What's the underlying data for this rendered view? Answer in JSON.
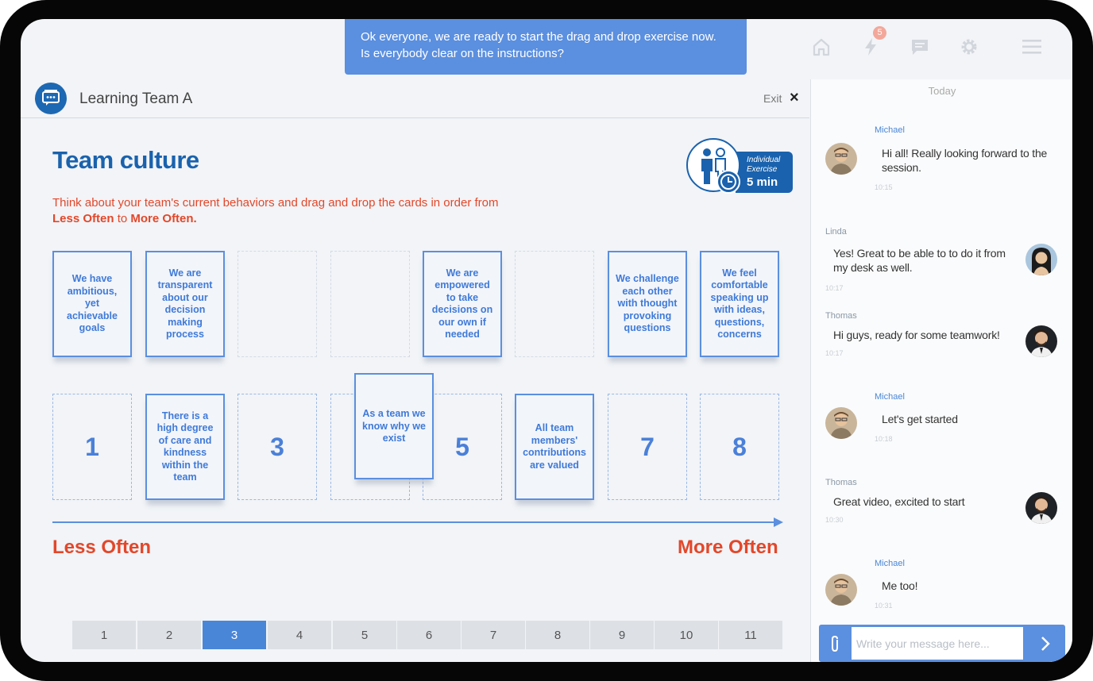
{
  "banner": {
    "line1": "Ok everyone, we are ready to start the drag and drop exercise now.",
    "line2": "Is everybody clear on the instructions?"
  },
  "top_icons": [
    {
      "name": "home-icon"
    },
    {
      "name": "lightning-icon",
      "badge": "5"
    },
    {
      "name": "chat-icon"
    },
    {
      "name": "gear-icon"
    },
    {
      "name": "menu-icon"
    }
  ],
  "header": {
    "team_name": "Learning Team A",
    "exit_label": "Exit",
    "close_symbol": "×"
  },
  "exercise": {
    "title": "Team culture",
    "instruction_part1": "Think about your team's current behaviors and drag and drop the cards in order from",
    "instruction_less": "Less Often",
    "instruction_to": "to",
    "instruction_more": "More Often.",
    "badge_type_line1": "Individual",
    "badge_type_line2": "Exercise",
    "badge_duration": "5 min"
  },
  "top_cards": [
    {
      "text": "We have ambitious, yet achievable goals"
    },
    {
      "text": "We are transparent about our decision making process"
    },
    {
      "text": ""
    },
    {
      "text": ""
    },
    {
      "text": "We are empowered to take decisions on our own if needed"
    },
    {
      "text": ""
    },
    {
      "text": "We challenge each other with thought provoking questions"
    },
    {
      "text": "We feel comfortable speaking up with ideas, questions, concerns"
    }
  ],
  "drop_slots": [
    "1",
    "2",
    "3",
    "4",
    "5",
    "6",
    "7",
    "8"
  ],
  "placed_cards": [
    {
      "slot": "2",
      "text": "There is a high degree of care and kindness within the team"
    },
    {
      "slot": "6",
      "text": "All team members' contributions are valued"
    }
  ],
  "dragging_card": {
    "text": "As a team we know why we exist"
  },
  "scale": {
    "less": "Less Often",
    "more": "More Often"
  },
  "pager": {
    "pages": [
      "1",
      "2",
      "3",
      "4",
      "5",
      "6",
      "7",
      "8",
      "9",
      "10",
      "11"
    ],
    "active": "3"
  },
  "chat": {
    "day_label": "Today",
    "messages": [
      {
        "name": "Michael",
        "text_l1": "Hi all! Really looking forward to the",
        "text_l2": "session.",
        "time": "10:15"
      },
      {
        "name": "Linda",
        "text_l1": "Yes! Great to be able to to do it from",
        "text_l2": "my desk as well.",
        "time": "10:17"
      },
      {
        "name": "Thomas",
        "text_l1": "Hi guys, ready for some teamwork!",
        "text_l2": "",
        "time": "10:17"
      },
      {
        "name": "Michael",
        "text_l1": "Let's get started",
        "text_l2": "",
        "time": "10:18"
      },
      {
        "name": "Thomas",
        "text_l1": "Great video, excited to start",
        "text_l2": "",
        "time": "10:30"
      },
      {
        "name": "Michael",
        "text_l1": "Me too!",
        "text_l2": "",
        "time": "10:31"
      }
    ],
    "input_placeholder": "Write your message here..."
  },
  "colors": {
    "primary_blue": "#1a62ad",
    "accent_blue": "#5b8fdf",
    "orange": "#e3472a",
    "badge_pink": "#f3a79a"
  }
}
